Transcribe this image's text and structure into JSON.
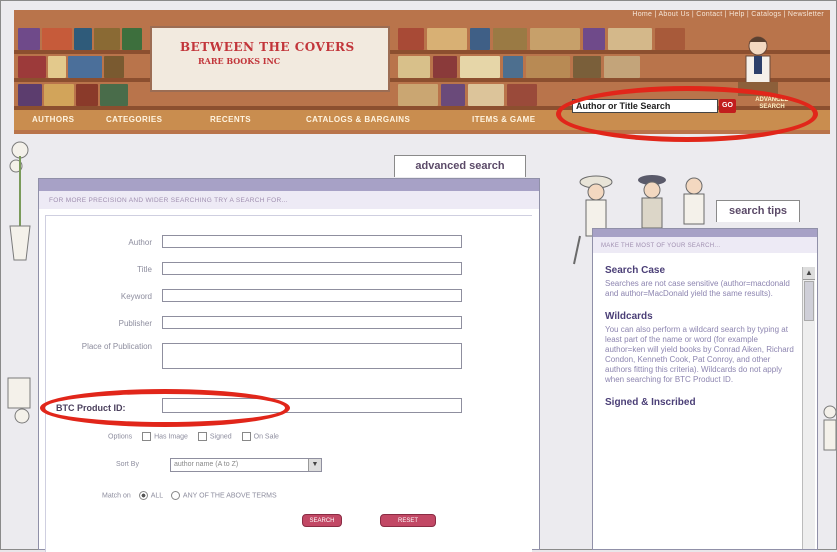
{
  "header": {
    "top_links": "Home | About Us | Contact | Help | Catalogs | Newsletter",
    "logo_title": "BETWEEN THE COVERS",
    "logo_subtitle": "RARE BOOKS INC",
    "nav": [
      "AUTHORS",
      "CATEGORIES",
      "RECENTS",
      "CATALOGS & BARGAINS",
      "ITEMS & GAME"
    ],
    "search_value": "Author or Title Search",
    "go_label": "GO",
    "advanced_link": "ADVANCED SEARCH"
  },
  "form": {
    "tab_label": "advanced search",
    "intro": "FOR MORE PRECISION AND WIDER SEARCHING TRY A SEARCH FOR...",
    "fields": [
      {
        "label": "Author"
      },
      {
        "label": "Title"
      },
      {
        "label": "Keyword"
      },
      {
        "label": "Publisher"
      },
      {
        "label": "Place of Publication"
      }
    ],
    "product_label": "BTC Product ID:",
    "options_label": "Options",
    "options": [
      "Has Image",
      "Signed",
      "On Sale"
    ],
    "sort_label": "Sort By",
    "sort_value": "author name (A to Z)",
    "match_label": "Match on",
    "match_options": [
      "ALL",
      "ANY OF THE ABOVE TERMS"
    ],
    "search_button": "SEARCH",
    "reset_button": "RESET"
  },
  "tips": {
    "tab_label": "search tips",
    "intro": "MAKE THE MOST OF YOUR SEARCH...",
    "sections": [
      {
        "title": "Search Case",
        "text": "Searches are not case sensitive (author=macdonald and author=MacDonald yield the same results)."
      },
      {
        "title": "Wildcards",
        "text": "You can also perform a wildcard search by typing at least part of the name or word (for example author=ken will yield books by Conrad Aiken, Richard Condon, Kenneth Cook, Pat Conroy, and other authors fitting this criteria). Wildcards do not apply when searching for BTC Product ID."
      },
      {
        "title": "Signed & Inscribed",
        "text": ""
      }
    ]
  },
  "colors": {
    "accent_red": "#e1261a",
    "header_brown": "#b9744b",
    "panel_purple": "#a7a1c6"
  }
}
